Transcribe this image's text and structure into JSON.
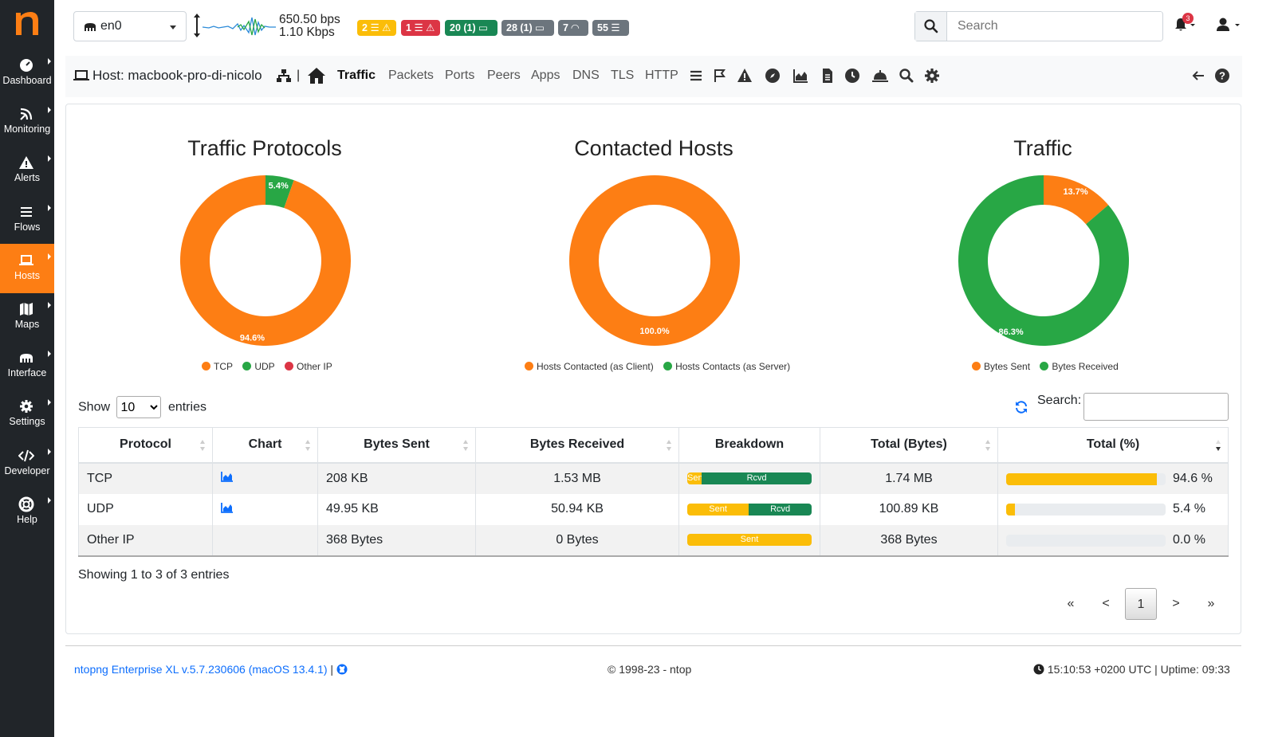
{
  "sidebar": {
    "items": [
      {
        "label": "Dashboard",
        "icon": "dashboard-icon"
      },
      {
        "label": "Monitoring",
        "icon": "monitoring-icon"
      },
      {
        "label": "Alerts",
        "icon": "alert-icon"
      },
      {
        "label": "Flows",
        "icon": "flows-icon"
      },
      {
        "label": "Hosts",
        "icon": "laptop-icon",
        "active": true
      },
      {
        "label": "Maps",
        "icon": "map-icon"
      },
      {
        "label": "Interface",
        "icon": "interface-icon"
      },
      {
        "label": "Settings",
        "icon": "gear-icon"
      },
      {
        "label": "Developer",
        "icon": "code-icon"
      },
      {
        "label": "Help",
        "icon": "lifebuoy-icon"
      }
    ]
  },
  "topbar": {
    "interface": "en0",
    "rate_up": "650.50 bps",
    "rate_down": "1.10 Kbps",
    "badges": [
      {
        "text": "2",
        "color": "#fbbd08"
      },
      {
        "text": "1",
        "color": "#dc3545"
      },
      {
        "text": "20 (1)",
        "color": "#198754"
      },
      {
        "text": "28 (1)",
        "color": "#6c757d"
      },
      {
        "text": "7",
        "color": "#6c757d"
      },
      {
        "text": "55",
        "color": "#6c757d"
      }
    ],
    "search_placeholder": "Search",
    "notification_count": "3"
  },
  "hostbar": {
    "host_label": "Host: macbook-pro-di-nicolo",
    "separator": "|",
    "links": [
      "Traffic",
      "Packets",
      "Ports",
      "Peers",
      "Apps",
      "DNS",
      "TLS",
      "HTTP"
    ],
    "active_link": "Traffic"
  },
  "charts": {
    "protocols": {
      "title": "Traffic Protocols",
      "legend": [
        "TCP",
        "UDP",
        "Other IP"
      ],
      "labels": [
        "94.6%",
        "5.4%"
      ]
    },
    "contacted": {
      "title": "Contacted Hosts",
      "legend": [
        "Hosts Contacted (as Client)",
        "Hosts Contacts (as Server)"
      ],
      "labels": [
        "100.0%"
      ]
    },
    "traffic": {
      "title": "Traffic",
      "legend": [
        "Bytes Sent",
        "Bytes Received"
      ],
      "labels": [
        "86.3%",
        "13.7%"
      ]
    }
  },
  "chart_data": [
    {
      "type": "pie",
      "title": "Traffic Protocols",
      "categories": [
        "TCP",
        "UDP",
        "Other IP"
      ],
      "values": [
        94.6,
        5.4,
        0.0
      ],
      "colors": [
        "#fd7e14",
        "#28a745",
        "#dc3545"
      ]
    },
    {
      "type": "pie",
      "title": "Contacted Hosts",
      "categories": [
        "Hosts Contacted (as Client)",
        "Hosts Contacts (as Server)"
      ],
      "values": [
        100.0,
        0.0
      ],
      "colors": [
        "#fd7e14",
        "#28a745"
      ]
    },
    {
      "type": "pie",
      "title": "Traffic",
      "categories": [
        "Bytes Sent",
        "Bytes Received"
      ],
      "values": [
        13.7,
        86.3
      ],
      "colors": [
        "#fd7e14",
        "#28a745"
      ]
    }
  ],
  "table": {
    "show_label": "Show",
    "entries_label": "entries",
    "page_size": "10",
    "search_label": "Search:",
    "headers": [
      "Protocol",
      "Chart",
      "Bytes Sent",
      "Bytes Received",
      "Breakdown",
      "Total (Bytes)",
      "Total (%)"
    ],
    "rows": [
      {
        "protocol": "TCP",
        "chart": true,
        "sent": "208 KB",
        "received": "1.53 MB",
        "sent_frac": 0.117,
        "sent_label": "Sent",
        "rcvd_label": "Rcvd",
        "total": "1.74 MB",
        "pct": 94.6,
        "pct_label": "94.6 %"
      },
      {
        "protocol": "UDP",
        "chart": true,
        "sent": "49.95 KB",
        "received": "50.94 KB",
        "sent_frac": 0.495,
        "sent_label": "Sent",
        "rcvd_label": "Rcvd",
        "total": "100.89 KB",
        "pct": 5.4,
        "pct_label": "5.4 %"
      },
      {
        "protocol": "Other IP",
        "chart": false,
        "sent": "368 Bytes",
        "received": "0 Bytes",
        "sent_frac": 1.0,
        "sent_label": "Sent",
        "rcvd_label": "",
        "total": "368 Bytes",
        "pct": 0.0,
        "pct_label": "0.0 %"
      }
    ],
    "info": "Showing 1 to 3 of 3 entries",
    "pager": [
      "«",
      "<",
      "1",
      ">",
      "»"
    ],
    "current_page": "1"
  },
  "footer": {
    "version": "ntopng Enterprise XL v.5.7.230606 (macOS 13.4.1)",
    "separator": "|",
    "copyright": "© 1998-23 - ntop",
    "time": "15:10:53 +0200 UTC | Uptime: 09:33"
  }
}
